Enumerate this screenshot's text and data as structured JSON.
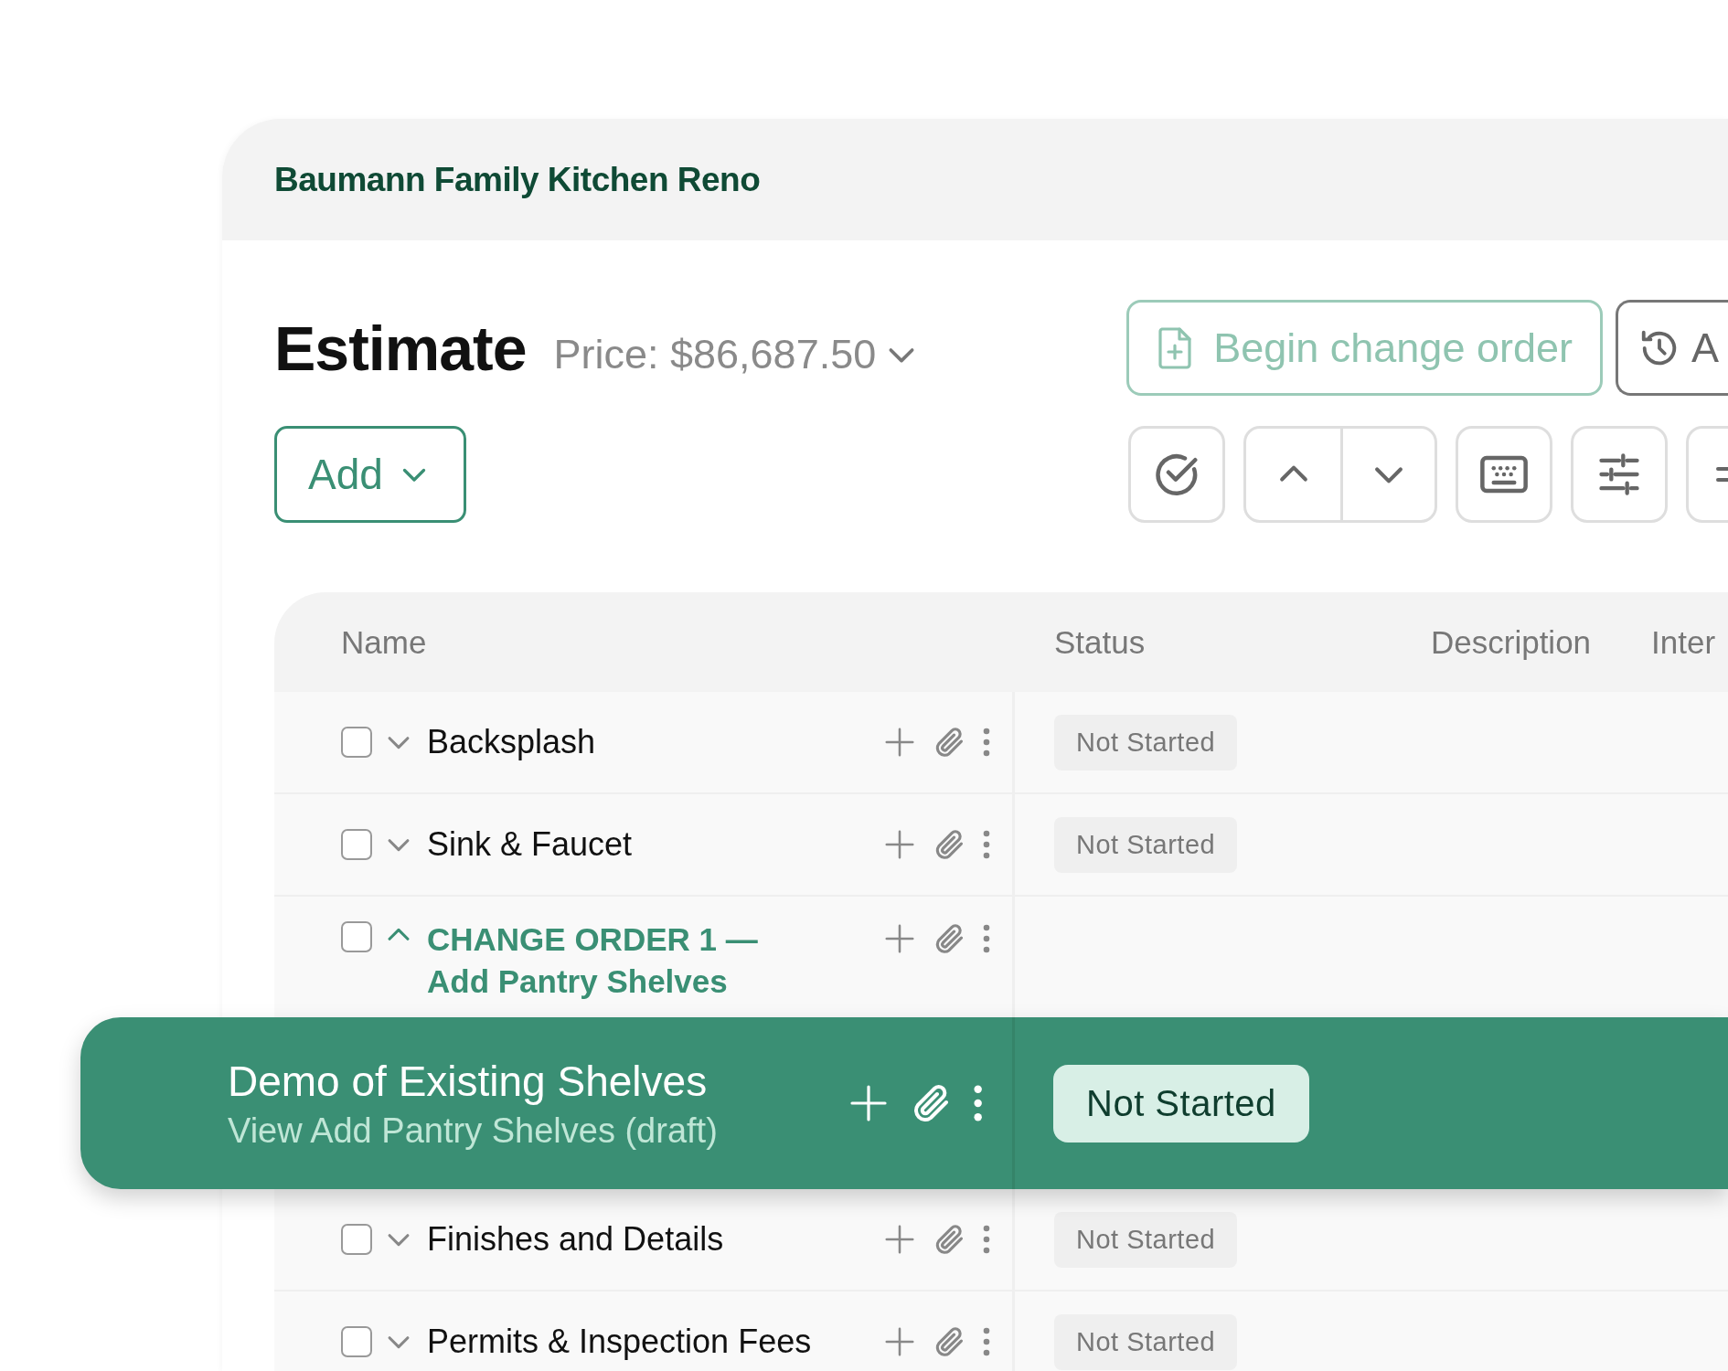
{
  "project_title": "Baumann Family Kitchen Reno",
  "estimate": {
    "title": "Estimate",
    "price": "Price: $86,687.50"
  },
  "actions": [
    {
      "kind": "change_order",
      "label": "Begin change order"
    },
    {
      "kind": "history",
      "label": "A"
    }
  ],
  "add_button": {
    "label": "Add"
  },
  "table": {
    "columns": [
      "Name",
      "Status",
      "Description",
      "Inter"
    ],
    "rows": [
      {
        "kind": "item",
        "name": "Backsplash",
        "checked": false,
        "expanded": false,
        "status": "Not Started"
      },
      {
        "kind": "item",
        "name": "Sink & Faucet",
        "checked": false,
        "expanded": false,
        "status": "Not Started"
      },
      {
        "kind": "change_order",
        "name": "CHANGE ORDER 1 —",
        "subtitle": "Add Pantry Shelves",
        "checked": false,
        "expanded": true
      },
      {
        "kind": "dragged",
        "name": "Demo of Existing Shelves",
        "subtitle": "View Add Pantry Shelves (draft)",
        "status": "Not Started"
      },
      {
        "kind": "item",
        "name": "Finishes and Details",
        "checked": false,
        "expanded": false,
        "status": "Not Started"
      },
      {
        "kind": "item",
        "name": "Permits & Inspection Fees",
        "checked": false,
        "expanded": false,
        "status": "Not Started"
      }
    ]
  }
}
